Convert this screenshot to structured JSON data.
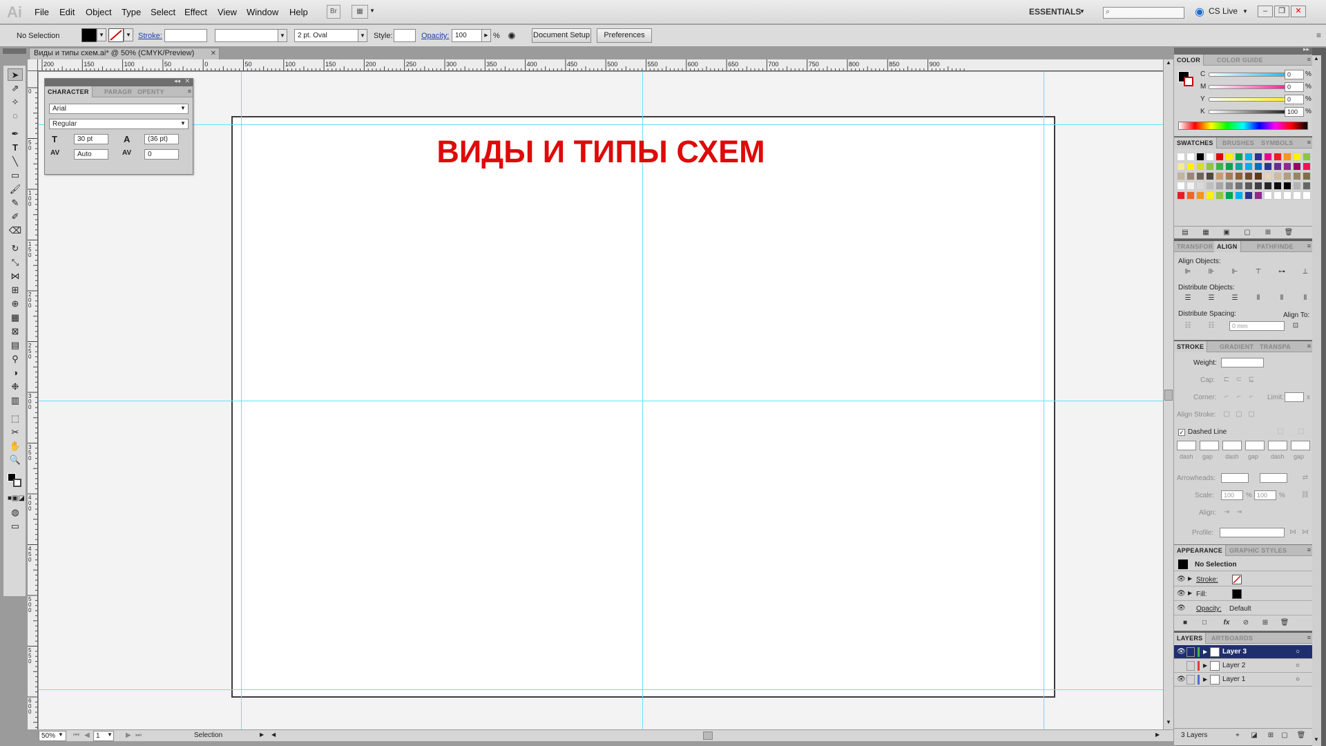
{
  "app": {
    "logo": "Ai"
  },
  "menu": {
    "items": [
      "File",
      "Edit",
      "Object",
      "Type",
      "Select",
      "Effect",
      "View",
      "Window",
      "Help"
    ],
    "bridge_label": "Br",
    "workspace": "ESSENTIALS",
    "cslive": "CS Live"
  },
  "control": {
    "selection_label": "No Selection",
    "stroke_label": "Stroke:",
    "brush_value": "2 pt. Oval",
    "style_label": "Style:",
    "opacity_label": "Opacity:",
    "opacity_value": "100",
    "percent": "%",
    "document_setup": "Document Setup",
    "preferences": "Preferences"
  },
  "document": {
    "tab_title": "Виды и типы схем.ai* @ 50% (CMYK/Preview)",
    "heading": "ВИДЫ И ТИПЫ СХЕМ",
    "ruler_h": [
      "200",
      "150",
      "100",
      "50",
      "0",
      "50",
      "100",
      "150",
      "200",
      "250",
      "300",
      "350",
      "400",
      "450",
      "500",
      "550",
      "600",
      "650",
      "700",
      "750",
      "800",
      "850",
      "900"
    ],
    "ruler_v": [
      "0",
      "50",
      "100",
      "150",
      "200",
      "250",
      "300",
      "350",
      "400",
      "450",
      "500",
      "550",
      "600"
    ]
  },
  "status": {
    "zoom": "50%",
    "page": "1",
    "tool": "Selection"
  },
  "character_panel": {
    "tabs": [
      "CHARACTER",
      "PARAGR",
      "OPENTY"
    ],
    "font": "Arial",
    "style": "Regular",
    "size": "30 pt",
    "leading": "(36 pt)",
    "kerning": "Auto",
    "tracking": "0"
  },
  "color_panel": {
    "tabs": [
      "COLOR",
      "COLOR GUIDE"
    ],
    "channels": [
      {
        "name": "C",
        "value": "0"
      },
      {
        "name": "M",
        "value": "0"
      },
      {
        "name": "Y",
        "value": "0"
      },
      {
        "name": "K",
        "value": "100"
      }
    ],
    "percent": "%"
  },
  "swatches_panel": {
    "tabs": [
      "SWATCHES",
      "BRUSHES",
      "SYMBOLS"
    ]
  },
  "align_panel": {
    "tabs": [
      "TRANSFOR",
      "ALIGN",
      "PATHFINDE"
    ],
    "align_objects": "Align Objects:",
    "distribute_objects": "Distribute Objects:",
    "distribute_spacing": "Distribute Spacing:",
    "align_to": "Align To:",
    "spacing_value": "0 mm"
  },
  "stroke_panel": {
    "tabs": [
      "STROKE",
      "GRADIENT",
      "TRANSPA"
    ],
    "weight": "Weight:",
    "cap": "Cap:",
    "corner": "Corner:",
    "limit": "Limit:",
    "limit_x": "x",
    "align_stroke": "Align Stroke:",
    "dashed_line": "Dashed Line",
    "dash_labels": [
      "dash",
      "gap",
      "dash",
      "gap",
      "dash",
      "gap"
    ],
    "arrowheads": "Arrowheads:",
    "scale": "Scale:",
    "scale_values": [
      "100",
      "100"
    ],
    "percent": "%",
    "align": "Align:",
    "profile": "Profile:"
  },
  "appearance_panel": {
    "tabs": [
      "APPEARANCE",
      "GRAPHIC STYLES"
    ],
    "title": "No Selection",
    "stroke": "Stroke:",
    "fill": "Fill:",
    "opacity": "Opacity:",
    "opacity_value": "Default"
  },
  "layers_panel": {
    "tabs": [
      "LAYERS",
      "ARTBOARDS"
    ],
    "layers": [
      {
        "name": "Layer 3",
        "color": "#4fb34f",
        "selected": true
      },
      {
        "name": "Layer 2",
        "color": "#e03b3b",
        "selected": false
      },
      {
        "name": "Layer 1",
        "color": "#4a6cd4",
        "selected": false
      }
    ],
    "count": "3 Layers"
  },
  "colors": {
    "heading_red": "#de0a0a",
    "guide_cyan": "#5fe5f0",
    "layer_selected": "#1f2f6e"
  }
}
